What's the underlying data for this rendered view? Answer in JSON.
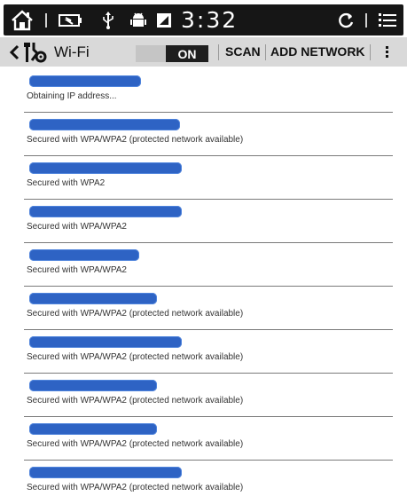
{
  "status_bar": {
    "time": "3:32",
    "icons": [
      "home-icon",
      "battery-icon",
      "usb-icon",
      "android-debug-icon",
      "sd-card-icon",
      "refresh-icon",
      "menu-list-icon"
    ]
  },
  "action_bar": {
    "title": "Wi-Fi",
    "toggle_label": "ON",
    "scan_label": "SCAN",
    "add_network_label": "ADD NETWORK",
    "icons": [
      "back-chevron-icon",
      "settings-tools-icon",
      "overflow-menu-icon"
    ]
  },
  "networks": [
    {
      "status": "Obtaining IP address..."
    },
    {
      "status": "Secured with WPA/WPA2 (protected network available)"
    },
    {
      "status": "Secured with WPA2"
    },
    {
      "status": "Secured with WPA/WPA2"
    },
    {
      "status": "Secured with WPA/WPA2"
    },
    {
      "status": "Secured with WPA/WPA2 (protected network available)"
    },
    {
      "status": "Secured with WPA/WPA2 (protected network available)"
    },
    {
      "status": "Secured with WPA/WPA2 (protected network available)"
    },
    {
      "status": "Secured with WPA/WPA2 (protected network available)"
    },
    {
      "status": "Secured with WPA/WPA2 (protected network available)"
    }
  ],
  "colors": {
    "status_bar_bg": "#161616",
    "action_bar_bg": "#d9d9d9",
    "redaction_blue": "#2e63c4"
  }
}
